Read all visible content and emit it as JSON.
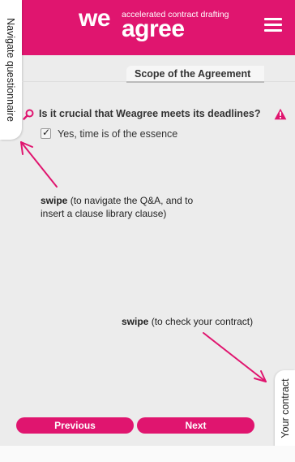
{
  "header": {
    "logo_we": "we",
    "logo_agree": "agree",
    "tagline": "accelerated contract drafting",
    "menu_icon": "hamburger-menu-icon"
  },
  "side_tabs": {
    "left_label": "Navigate questionnaire",
    "right_label": "Your contract"
  },
  "section": {
    "title": "Scope of the Agreement"
  },
  "question": {
    "text": "Is it crucial that Weagree meets its deadlines?",
    "icon_left": "search-icon",
    "icon_right": "warning-icon"
  },
  "answer": {
    "label": "Yes, time is of the essence",
    "checked": true
  },
  "hints": {
    "left_bold": "swipe",
    "left_text": " (to navigate the Q&A, and to insert a clause library clause)",
    "right_bold": "swipe",
    "right_text": " (to check your contract)"
  },
  "nav": {
    "previous_label": "Previous",
    "next_label": "Next"
  },
  "colors": {
    "brand": "#e0156f",
    "background": "#ececec"
  }
}
